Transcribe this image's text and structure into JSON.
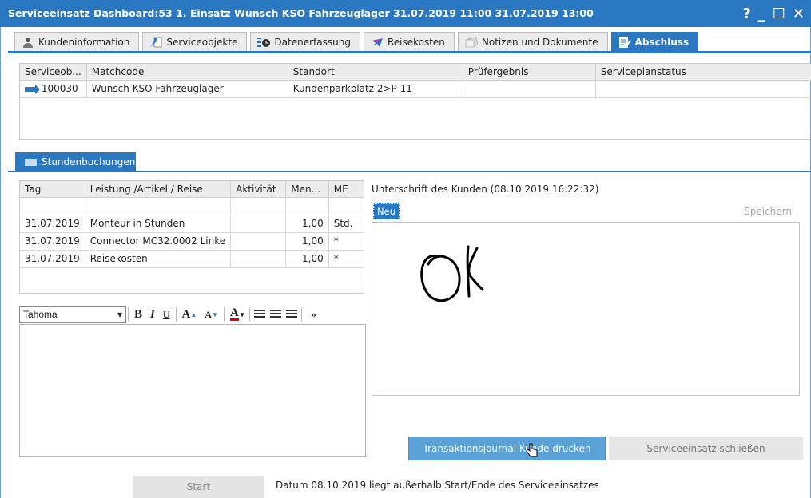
{
  "window": {
    "title": "Serviceeinsatz Dashboard:53 1. Einsatz Wunsch KSO Fahrzeuglager 31.07.2019 11:00 31.07.2019 13:00",
    "help": "?",
    "minimize": "_",
    "maximize": "☐",
    "close": "✕"
  },
  "tabs": [
    {
      "label": "Kundeninformation",
      "icon": "user-icon"
    },
    {
      "label": "Serviceobjekte",
      "icon": "wrench-icon"
    },
    {
      "label": "Datenerfassung",
      "icon": "clock-icon"
    },
    {
      "label": "Reisekosten",
      "icon": "plane-icon"
    },
    {
      "label": "Notizen und Dokumente",
      "icon": "notes-icon"
    },
    {
      "label": "Abschluss",
      "icon": "checklist-icon",
      "active": true
    }
  ],
  "service_objects": {
    "headers": [
      "Serviceob...",
      "Matchcode",
      "Standort",
      "Prüfergebnis",
      "Serviceplanstatus"
    ],
    "rows": [
      [
        "100030",
        "Wunsch KSO Fahrzeuglager",
        "Kundenparkplatz 2>P 11",
        "",
        ""
      ]
    ]
  },
  "subtab": {
    "label": "Stundenbuchungen"
  },
  "bookings": {
    "headers": [
      "Tag",
      "Leistung /Artikel / Reise",
      "Aktivität",
      "Men...",
      "ME"
    ],
    "rows": [
      [
        "",
        "",
        "",
        "",
        ""
      ],
      [
        "31.07.2019",
        "Monteur in Stunden",
        "",
        "1,00",
        "Std."
      ],
      [
        "31.07.2019",
        "Connector MC32.0002 Linke",
        "",
        "1,00",
        "*"
      ],
      [
        "31.07.2019",
        "Reisekosten",
        "",
        "1,00",
        "*"
      ]
    ]
  },
  "editor": {
    "font": "Tahoma",
    "more": "»"
  },
  "signature": {
    "label": "Unterschrift des Kunden (08.10.2019 16:22:32)",
    "new_label": "Neu",
    "save_label": "Speichern"
  },
  "buttons": {
    "journal": "Transaktionsjournal Kunde drucken",
    "close_service": "Serviceeinsatz schließen",
    "start": "Start"
  },
  "status": "Datum 08.10.2019 liegt außerhalb Start/Ende des Serviceeinsatzes",
  "colors": {
    "accent": "#2b78c2",
    "primary_button": "#5aa2d8"
  }
}
